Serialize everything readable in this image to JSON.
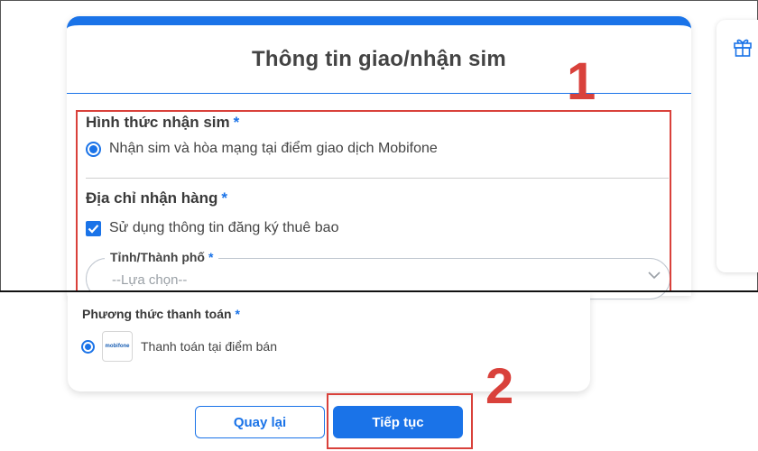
{
  "form": {
    "title": "Thông tin giao/nhận sim",
    "receive_method": {
      "label": "Hình thức nhận sim",
      "required_mark": "*",
      "selected_option": "Nhận sim và hòa mạng tại điểm giao dịch Mobifone"
    },
    "delivery_address": {
      "label": "Địa chỉ nhận hàng",
      "required_mark": "*",
      "checkbox_label": "Sử dụng thông tin đăng ký thuê bao",
      "checkbox_checked": true,
      "province_field": {
        "label": "Tỉnh/Thành phố",
        "required_mark": "*",
        "placeholder": "--Lựa chọn--"
      }
    },
    "payment": {
      "label": "Phương thức thanh toán",
      "required_mark": "*",
      "option_logo_text": "mobifone",
      "option_text": "Thanh toán tại điểm bán"
    }
  },
  "buttons": {
    "back_label": "Quay lại",
    "next_label": "Tiếp tục"
  },
  "annotations": {
    "step1": "1",
    "step2": "2"
  },
  "icons": [
    "gift-icon",
    "chevron-down-icon",
    "check-icon"
  ],
  "colors": {
    "accent": "#1a73e8",
    "annotation": "#d9413b"
  }
}
